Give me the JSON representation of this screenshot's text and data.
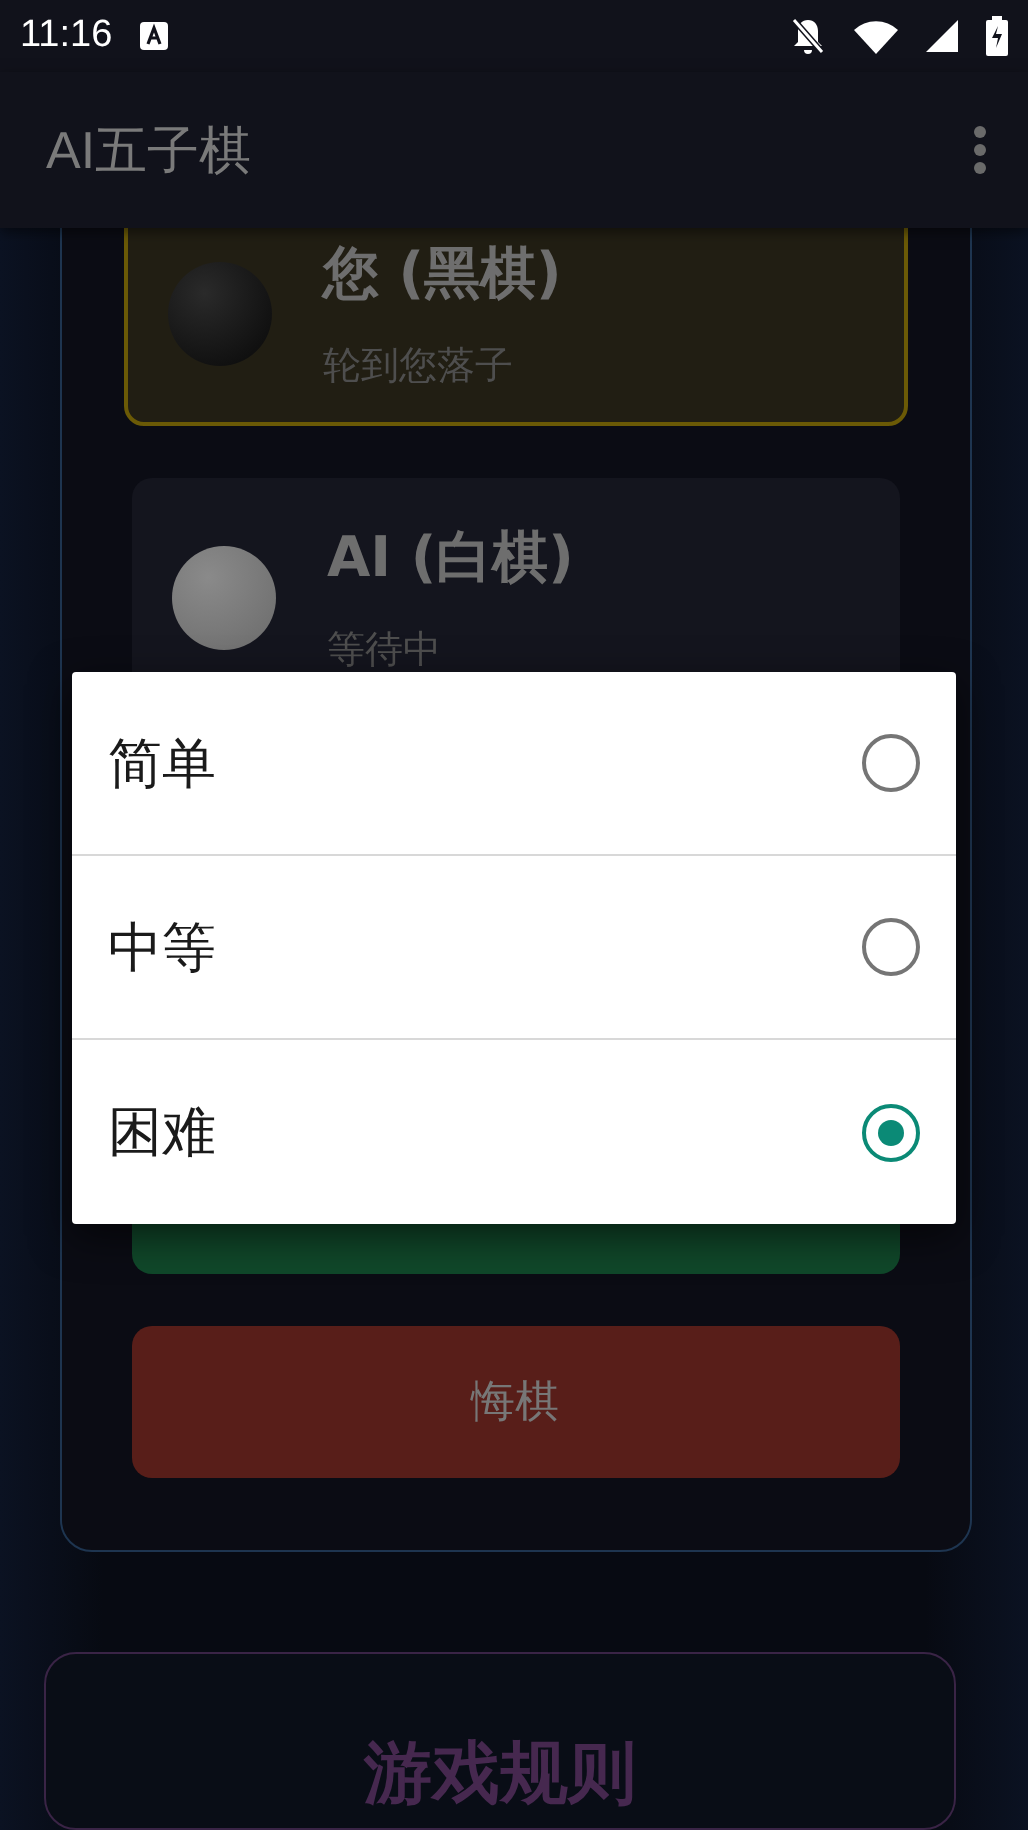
{
  "status_bar": {
    "time": "11:16"
  },
  "app_bar": {
    "title": "AI五子棋"
  },
  "players": [
    {
      "kind": "black",
      "name": "您 (黑棋)",
      "status": "轮到您落子",
      "selected": true
    },
    {
      "kind": "white",
      "name": "AI (白棋)",
      "status": "等待中",
      "selected": false
    }
  ],
  "undo_button": "悔棋",
  "rules_card": {
    "title": "游戏规则"
  },
  "dialog": {
    "options": [
      {
        "label": "简单",
        "selected": false
      },
      {
        "label": "中等",
        "selected": false
      },
      {
        "label": "困难",
        "selected": true
      }
    ]
  }
}
